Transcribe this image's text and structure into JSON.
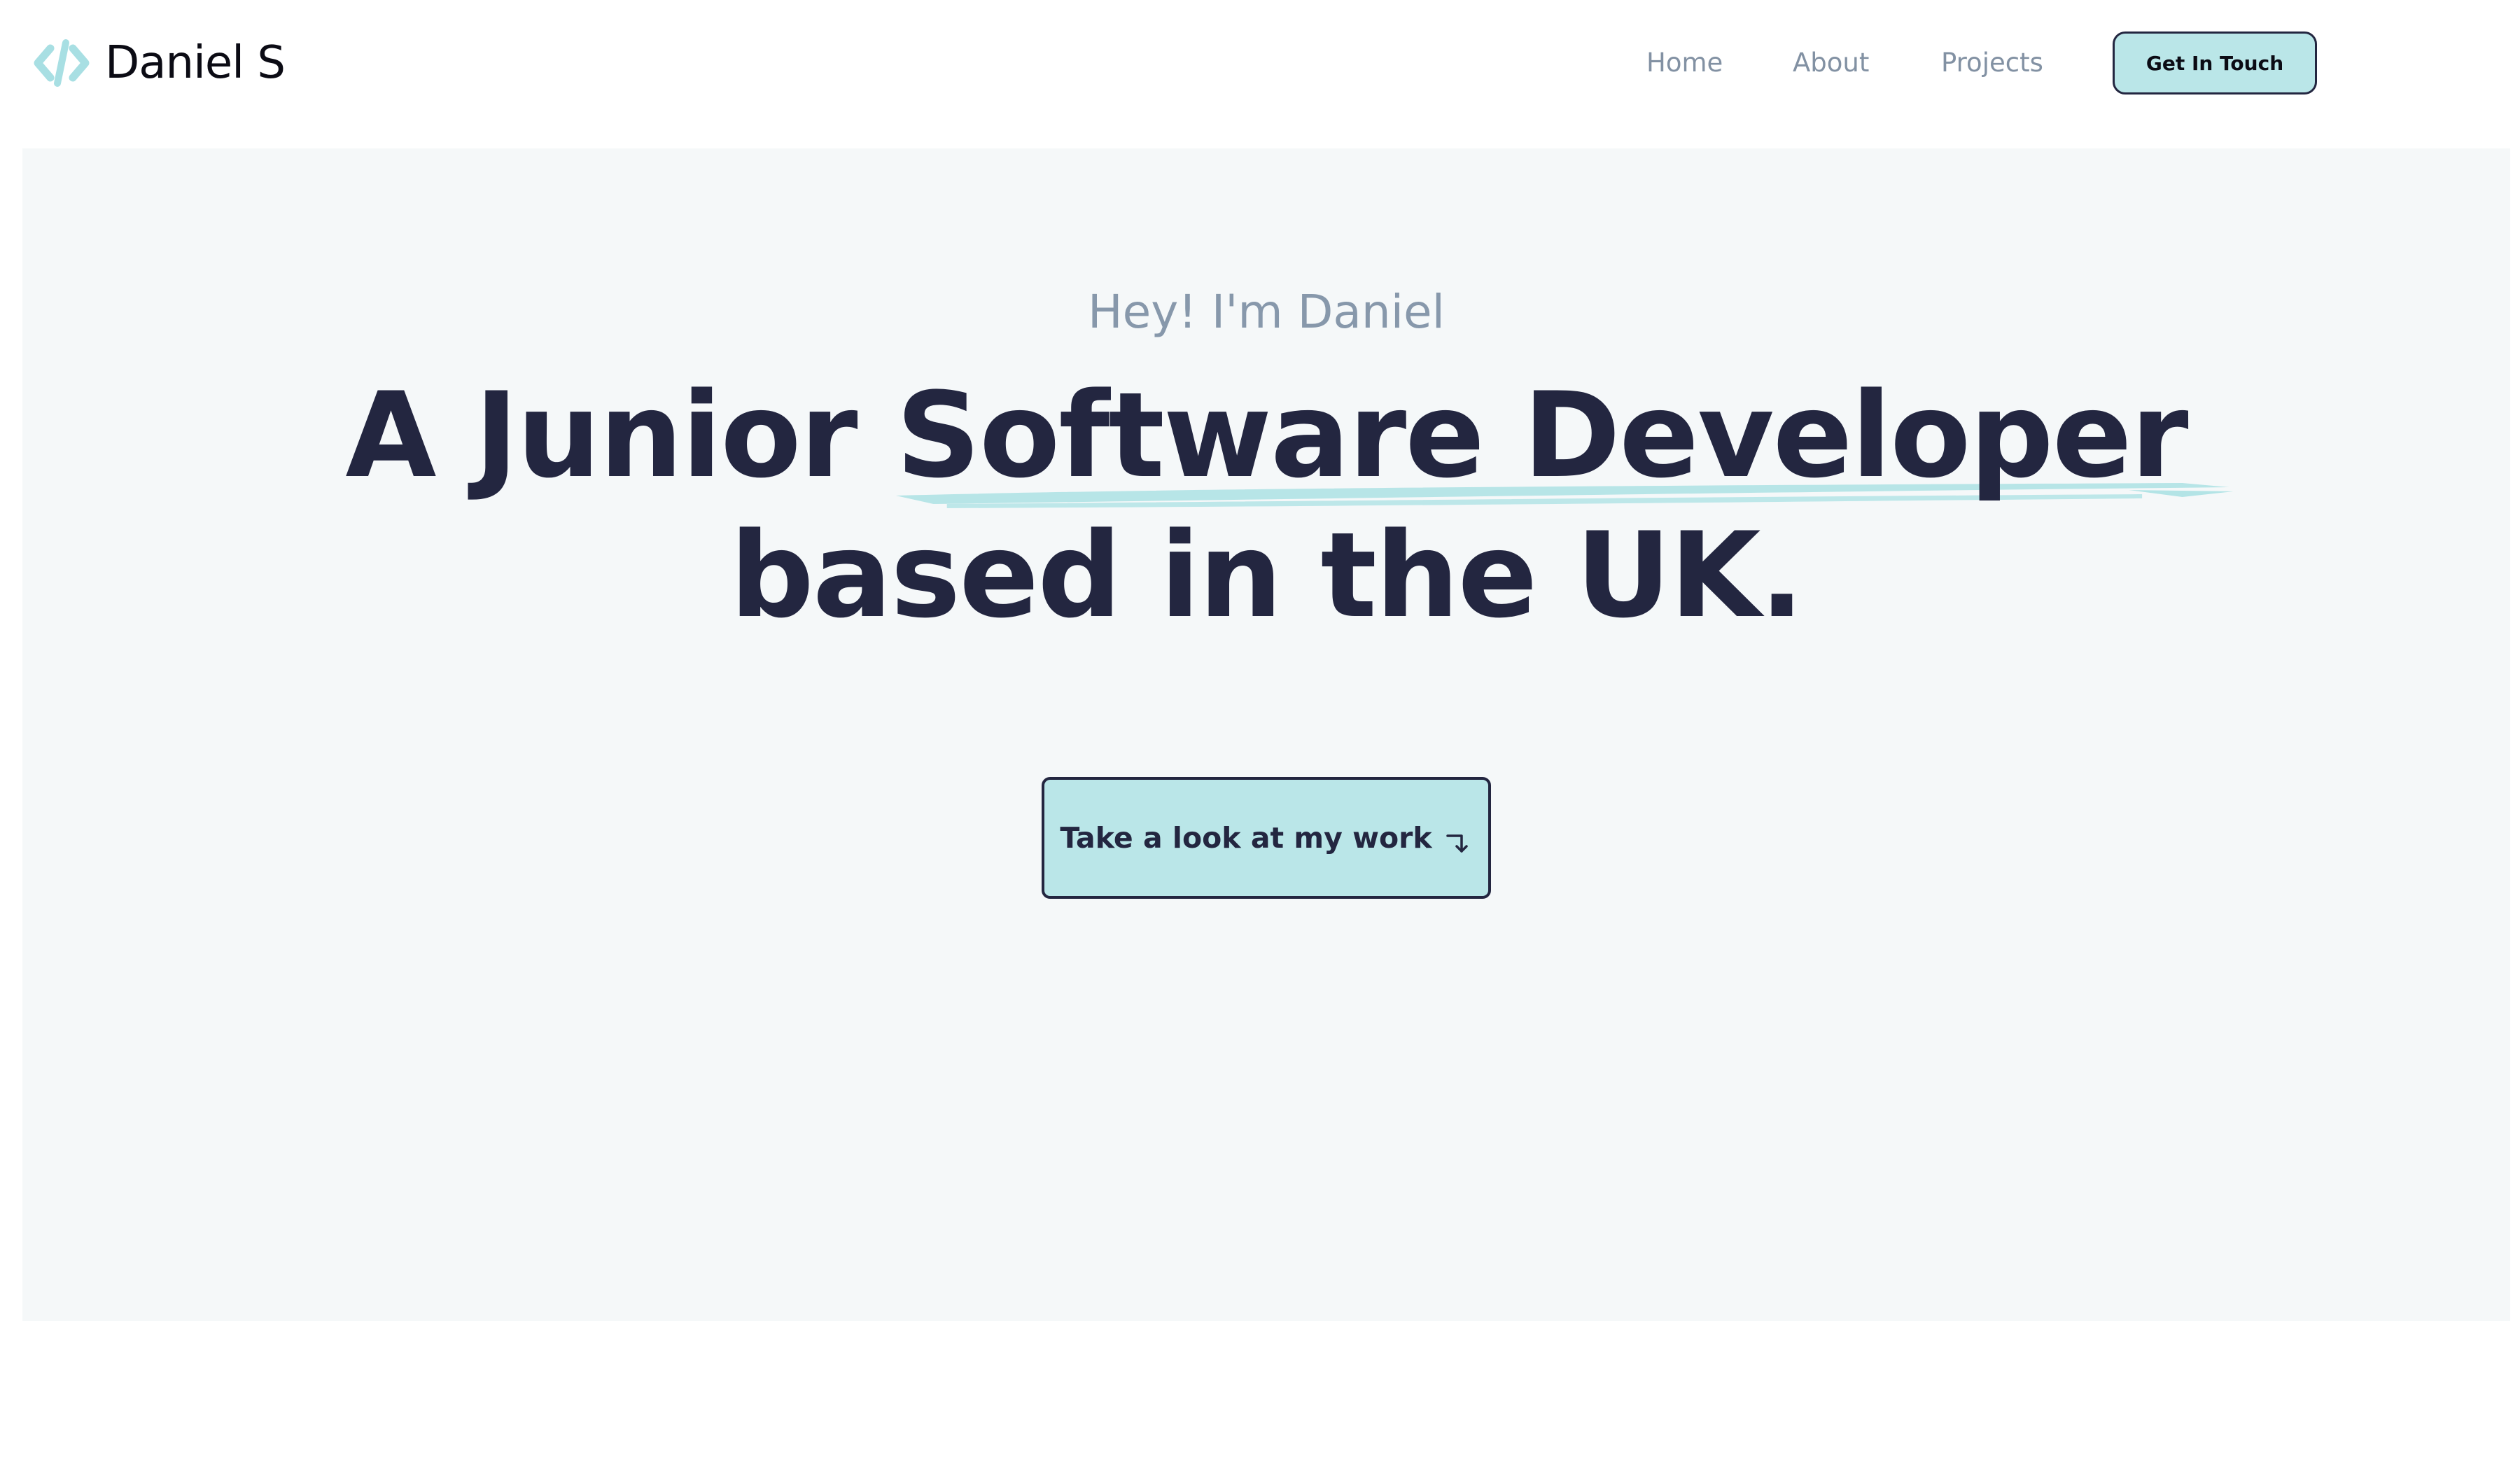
{
  "brand": {
    "name": "Daniel S",
    "icon": "code-brackets-icon"
  },
  "nav": {
    "home": "Home",
    "about": "About",
    "projects": "Projects",
    "cta_label": "Get In Touch"
  },
  "hero": {
    "greeting": "Hey! I'm Daniel",
    "headline_prefix": "A Junior ",
    "headline_highlight": "Software Developer",
    "headline_line2": "based in the UK.",
    "cta_label": "Take a look at my work",
    "cta_icon": "arrow-turn-down-right-icon"
  },
  "colors": {
    "accent": "#bae6e8",
    "text_dark": "#232640",
    "text_muted": "#8798ab",
    "hero_bg": "#f5f8f9"
  }
}
